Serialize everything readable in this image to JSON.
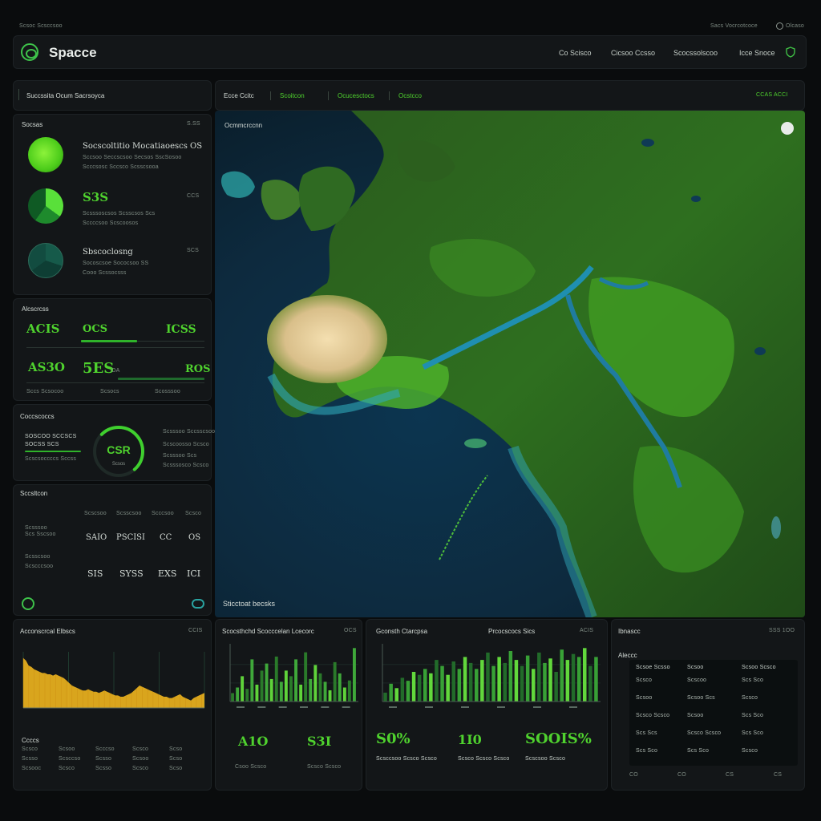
{
  "top_right": {
    "text1": "Sacs Vocrcotcoce",
    "text2": "Olcaso"
  },
  "header": {
    "brand": "Spacce",
    "nav": [
      "Co Scisco",
      "Cicsoo Ccsso",
      "Scocssolscoo",
      "Icce Snoce"
    ]
  },
  "left_top_tab": "Succssita Ocum Sacrsoyca",
  "map_toolbar": {
    "tabs": [
      "Ecce Ccitc",
      "Scoitcon",
      "Ocucesctocs",
      "Ocstcco"
    ],
    "right": "CCAS ACCI"
  },
  "summary_panel": {
    "title": "Socsas",
    "badge": "S.SS",
    "items": [
      {
        "title": "Socscoltitio Mocatiaoescs OS",
        "sub1": "Sccsoo Seccscsoo Secsos SscSosoo",
        "sub2": "Scccsosc Sccsco Scsscsooa",
        "badge": ""
      },
      {
        "title": "S3S",
        "sub1": "Scsssoscsos Scsscsos Scs",
        "sub2": "Sccccsoo Scscoosos",
        "badge": "CCS"
      },
      {
        "title": "Sbscoclosng",
        "sub1": "Socoscsoe Sococsoo SS",
        "sub2": "Cooo Scssocsss",
        "badge": "SCS"
      }
    ]
  },
  "metrics_panel": {
    "title": "Alcscrcss",
    "row1": {
      "a": "ACIS",
      "b": "OCS",
      "c": "ICSS"
    },
    "row2": {
      "a": "AS3O",
      "b": "5ES",
      "b_small": "OA",
      "c": "ROS"
    },
    "foot": [
      "Sccs Scsocoo",
      "Scsocs",
      "Scosssoo"
    ]
  },
  "gauge_panel": {
    "title": "Coccscoccs",
    "left1": "SOSCOO SCCSCS",
    "left2": "SOCSS SCS",
    "left3": "Scscsoccccs Sccss",
    "center": "CSR",
    "center_sub": "Scsos",
    "right": [
      "Scsssoo Sccsscsoo",
      "Scscoosso Scsco",
      "Scsssoo Scs",
      "Scsssosco Scsco"
    ],
    "progress": 0.68
  },
  "stats_panel": {
    "title": "Sccsltcon",
    "cols": [
      "Scscsoo",
      "Scsscsoo",
      "Scccsoo",
      "Scsco"
    ],
    "row1_label": "Scsssoo",
    "row1_sub": "Scs Sscsoo",
    "row1": [
      "SAIO",
      "PSCISI",
      "CC",
      "OS"
    ],
    "row2_label": "Scsscsoo",
    "row2_sub": "Scscccsoo",
    "row2": [
      "SIS",
      "SYSS",
      "EXS",
      "ICI"
    ]
  },
  "map": {
    "label_top": "Ocmmcrccnn",
    "label_bottom": "Sticctoat becsks"
  },
  "area_panel": {
    "title": "Acconscrcal Elbscs",
    "badge": "CCIS",
    "subtitle": "Ccccs",
    "table": [
      [
        "Scsco",
        "Scsoo",
        "Scccso",
        "Scsco",
        "Scso"
      ],
      [
        "Scsso",
        "Scsccso",
        "Scsso",
        "Scsoo",
        "Scso"
      ],
      [
        "Scsooc",
        "Scsco",
        "Scsso",
        "Scsco",
        "Scso"
      ]
    ],
    "chart_data": {
      "type": "area",
      "values": [
        40,
        38,
        34,
        33,
        31,
        30,
        29,
        28,
        28,
        27,
        27,
        26,
        27,
        26,
        25,
        24,
        22,
        20,
        18,
        17,
        16,
        15,
        14,
        14,
        15,
        14,
        13,
        13,
        12,
        13,
        14,
        13,
        12,
        11,
        10,
        10,
        9,
        9,
        10,
        11,
        12,
        14,
        16,
        18,
        17,
        16,
        15,
        14,
        13,
        12,
        11,
        10,
        9,
        9,
        8,
        8,
        9,
        10,
        11,
        9,
        8,
        7,
        6,
        8,
        9,
        10,
        11,
        12
      ],
      "color": "#f0b51e"
    }
  },
  "bar_panel_1": {
    "title": "Scocsthchd Scocccelan Lcecorc",
    "badge": "OCS",
    "value1": "A1O",
    "value2": "S3I",
    "sub1": "Csoo Scsco",
    "sub2": "Scsco Scsco",
    "chart_data": {
      "type": "bar",
      "values": [
        6,
        10,
        18,
        9,
        30,
        12,
        22,
        27,
        16,
        32,
        14,
        22,
        18,
        30,
        12,
        35,
        16,
        26,
        20,
        14,
        8,
        28,
        20,
        10,
        15,
        38
      ],
      "colors": [
        "#2a7a2a",
        "#3fa83a",
        "#5fd33a"
      ]
    }
  },
  "bar_panel_2": {
    "title": "Gconsth Ctarcpsa",
    "title_right": "Prcocscocs Sics",
    "badge": "ACIS",
    "value1": "S0%",
    "value2": "1I0",
    "value3": "SOOIS%",
    "sub1": "Scsccsoo Scsco Scsco",
    "sub2": "Scsco Scsco Scsco",
    "sub3": "Scscsoo Scsco",
    "chart_data": {
      "type": "bar",
      "values": [
        6,
        12,
        9,
        16,
        14,
        20,
        18,
        22,
        19,
        28,
        24,
        18,
        27,
        22,
        30,
        26,
        22,
        28,
        33,
        24,
        30,
        26,
        34,
        28,
        24,
        31,
        22,
        33,
        26,
        29,
        20,
        35,
        28,
        32,
        30,
        36,
        24,
        30
      ],
      "colors": [
        "#226b2a",
        "#38a136",
        "#62d83c"
      ]
    }
  },
  "right_table_panel": {
    "title": "Ibnascc",
    "badge": "SSS 1OO",
    "subtitle": "Aleccc",
    "headers": [
      "Scsoe Scsso",
      "Scsoo",
      "Scsoo Scsco"
    ],
    "rows": [
      [
        "Scsco",
        "Scscoo",
        "Scs Sco"
      ],
      [
        "Scsoo",
        "Scsoo Scs",
        "Scsco"
      ],
      [
        "Scsco Scsco",
        "Scsoo",
        "Scs Sco"
      ],
      [
        "Scs Scs",
        "Scsco Scsco",
        "Scs Sco"
      ],
      [
        "Scs Sco",
        "Scs Sco",
        "Scsco"
      ]
    ],
    "axis": [
      "CO",
      "CO",
      "CS",
      "CS"
    ]
  }
}
